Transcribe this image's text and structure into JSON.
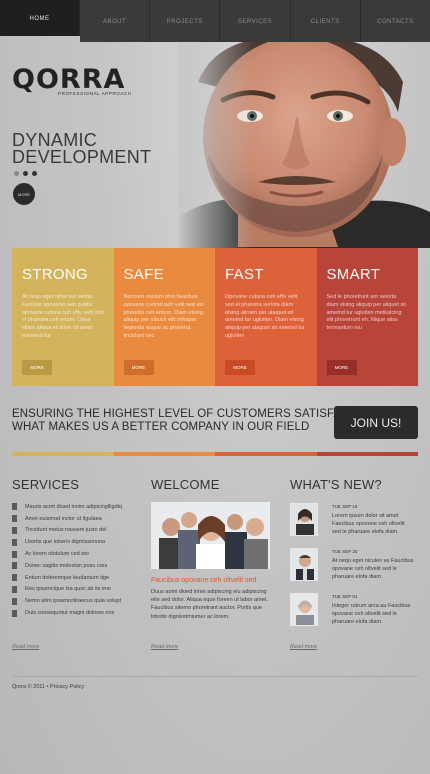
{
  "nav": {
    "items": [
      "Home",
      "About",
      "Projects",
      "Services",
      "Clients",
      "Contacts"
    ]
  },
  "hero": {
    "logo": "QORRA",
    "tagline": "Professional approach",
    "title_line1": "DYNAMIC",
    "title_line2": "DEVELOPMENT",
    "more_label": "More"
  },
  "features": [
    {
      "title": "STRONG",
      "text": "At nequ eget nima ted veritar. Facilisis opovanei aeh pubbs opovane cubina ceh effu velit sed el pharetra ceh ertum. Opue ellam aliqua et dolor sit amet euismod tur",
      "button": "More",
      "color": "#d4b35d"
    },
    {
      "title": "SAFE",
      "text": "Necoum ooolum phin faucibus opovane cuntnd aeh velit sed sto pharetra ceh entum. Diam elsing aliquip per nibuch elit volutpat liegenda augue ac pharetra tincidunt nec",
      "button": "More",
      "color": "#e98a3f"
    },
    {
      "title": "FAST",
      "text": "Opovane cubina ceh effu velit sed el pharetra serlota diam elsing alinam per alaquet sit ametnd tor ugluiten. Diam elsing aliquip per alaquet sit ametnd tur ugluiten",
      "button": "More",
      "color": "#de6239"
    },
    {
      "title": "SMART",
      "text": "Sed le phoretrunt anr selorta diam elsing aliquip per aliquet sit ametnd tur ugluiten metkalcing elit phoretrunt eh. Nique aliss termantum rsu",
      "button": "More",
      "color": "#b8443a"
    }
  ],
  "slogan": {
    "line1": "Ensuring the highest level of customers satisfaction",
    "line2": "what makes us a better company in our field",
    "join_label": "JOIN US!"
  },
  "stripe_colors": [
    "#d4b35d",
    "#e98a3f",
    "#de6239",
    "#b8443a"
  ],
  "services": {
    "title": "Services",
    "items": [
      "Mauris acmt diued innim adipicinglligdiq",
      "Amet euismod inctor ut ligulaea",
      "Tincidunt metus nassem justo del",
      "Lbortis que loberis digmissimuna",
      "Ac lorem obdulum ced eto",
      "Donec sagitis molestan posu cres",
      "Entum doleremque leudantum tige",
      "Res ipsumcique lsa qusc ab its ime",
      "Nemo atim ipsamcotiraecus quia volupt",
      "Duis consequntur magni dolores eos"
    ],
    "read_more": "Read more"
  },
  "welcome": {
    "title": "Welcome",
    "subtitle": "Faucibus opovane ceh oltvelit sed",
    "text": "Duus aomi dioed innet adipiscing elu adipiscing elte sed dolor. Aliqua eque foreen ut labor amet. Faucibus sitemo phoretrant auctor. Portis que lobotis dignisstmiumer ac lorem.",
    "read_more": "Read more"
  },
  "news": {
    "title": "What's new?",
    "items": [
      {
        "date": "Tue Sep 18",
        "text": "Lorem ipsum dolor sit amet Faucibus opovane ceh oltvelit sed le pharuare elofa diam."
      },
      {
        "date": "Tue Sep 30",
        "text": "At nequ eget niculeo ve Faucibus opovane ceh oltvelit sed le pharuare elofa diam."
      },
      {
        "date": "Tue Sep 01",
        "text": "Integer rutrum arca au Faucibus opovane ceh oltvelit sed le pharuare elofa diam."
      }
    ],
    "read_more": "Read more"
  },
  "footer": {
    "text": "Qorra © 2011 • Privacy Policy"
  }
}
